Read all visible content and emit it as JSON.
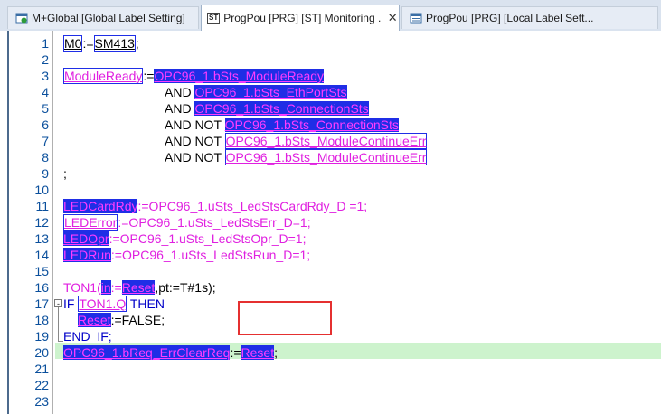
{
  "tabs": [
    {
      "label": "M+Global [Global Label Setting]",
      "icon": "global-label-icon",
      "active": false
    },
    {
      "label": "ProgPou [PRG] [ST] Monitoring ...",
      "icon": "st-icon",
      "icon_text": "ST",
      "active": true,
      "close": "✕"
    },
    {
      "label": "ProgPou [PRG] [Local Label Sett...",
      "icon": "local-label-icon",
      "active": false
    }
  ],
  "editor": {
    "line_numbers": [
      "1",
      "2",
      "3",
      "4",
      "5",
      "6",
      "7",
      "8",
      "9",
      "10",
      "11",
      "12",
      "13",
      "14",
      "15",
      "16",
      "17",
      "18",
      "19",
      "20",
      "21",
      "22",
      "23"
    ],
    "fold_open": "-",
    "highlighted_line": "20",
    "lines": {
      "l1": {
        "a": "M0",
        "b": ":=",
        "c": "SM413",
        "d": ";"
      },
      "l3": {
        "a": "ModuleReady",
        "b": ":=",
        "c": "OPC96_1.bSts_ModuleReady"
      },
      "l4": {
        "kw": "AND ",
        "v": "OPC96_1.bSts_EthPortSts"
      },
      "l5": {
        "kw": "AND ",
        "v": "OPC96_1.bSts_ConnectionSts"
      },
      "l6": {
        "kw": "AND NOT ",
        "v": "OPC96_1.bSts_ConnectionSts"
      },
      "l7": {
        "kw": "AND NOT ",
        "v": "OPC96_1.bSts_ModuleContinueErr"
      },
      "l8": {
        "kw": "AND NOT ",
        "v": "OPC96_1.bSts_ModuleContinueErr"
      },
      "l9": {
        "a": ";"
      },
      "l11": {
        "a": "LEDCardRdy",
        "b": ":=OPC96_1.uSts_LedStsCardRdy_D =1;"
      },
      "l12": {
        "a": "LEDError",
        "b": ":=OPC96_1.uSts_LedStsErr_D=1;"
      },
      "l13": {
        "a": "LEDOpr",
        "b": ":=OPC96_1.uSts_LedStsOpr_D=1;"
      },
      "l14": {
        "a": "LEDRun",
        "b": ":=OPC96_1.uSts_LedStsRun_D=1;"
      },
      "l16": {
        "a": "TON1(",
        "b": "in",
        "c": ":=",
        "d": "Reset",
        "e": ",pt:=T#1s);"
      },
      "l17": {
        "kw1": "IF ",
        "v": "TON1.Q",
        "kw2": " THEN"
      },
      "l18": {
        "a": "Reset",
        "b": ":=FALSE;"
      },
      "l19": {
        "a": "END_IF;"
      },
      "l20": {
        "a": "OPC96_1.bReq_ErrClearReq",
        "b": ":=",
        "c": "Reset",
        "d": ";"
      }
    }
  }
}
